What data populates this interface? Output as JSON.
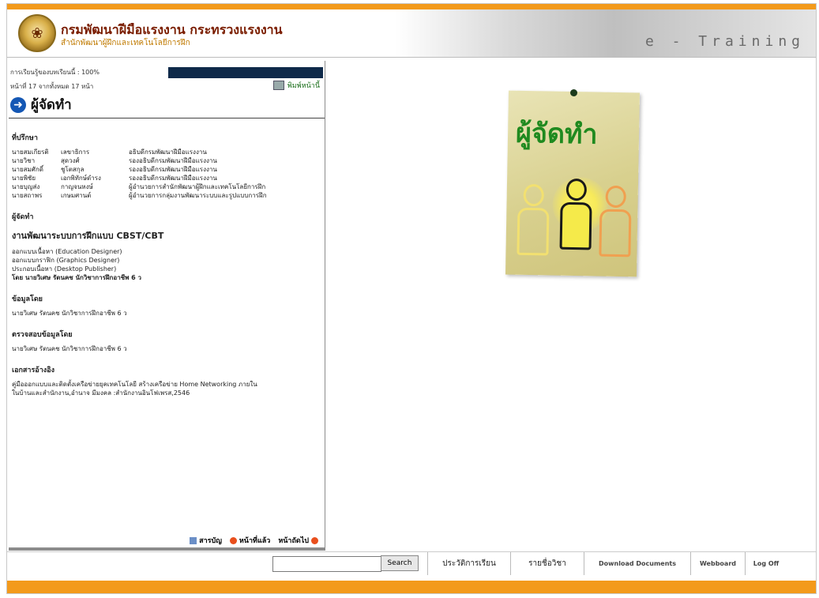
{
  "header": {
    "org_name": "กรมพัฒนาฝีมือแรงงาน กระทรวงแรงงาน",
    "org_sub": "สำนักพัฒนาผู้ฝึกและเทคโนโลยีการฝึก",
    "brand": "e - Training"
  },
  "progress": {
    "label": "การเรียนรู้ของบทเรียนนี้ : 100%",
    "value": 1.0
  },
  "page_info": "หน้าที่ 17 จากทั้งหมด 17 หน้า",
  "print_label": "พิมพ์หน้านี้",
  "page_title": "ผู้จัดทำ",
  "advisors": {
    "heading": "ที่ปรึกษา",
    "rows": [
      {
        "first": "นายสมเกียรติ",
        "last": "เลขาธิการ",
        "pos": "อธิบดีกรมพัฒนาฝีมือแรงงาน"
      },
      {
        "first": "นายวิชา",
        "last": "สุดวงศ์",
        "pos": "รองอธิบดีกรมพัฒนาฝีมือแรงงาน"
      },
      {
        "first": "นายสมศักดิ์",
        "last": "ชูโตสกุล",
        "pos": "รองอธิบดีกรมพัฒนาฝีมือแรงงาน"
      },
      {
        "first": "นายพิชัย",
        "last": "เอกพิทักษ์ดำรง",
        "pos": "รองอธิบดีกรมพัฒนาฝีมือแรงงาน"
      },
      {
        "first": "นายบุญส่ง",
        "last": "กาญจนหงษ์",
        "pos": "ผู้อำนวยการสำนักพัฒนาผู้ฝึกและเทคโนโลยีการฝึก"
      },
      {
        "first": "นายสถาพร",
        "last": "เกษมศานต์",
        "pos": "ผู้อำนวยการกลุ่มงานพัฒนาระบบและรูปแบบการฝึก"
      }
    ]
  },
  "authors": {
    "heading": "ผู้จัดทำ",
    "subheading": "งานพัฒนาระบบการฝึกแบบ CBST/CBT",
    "lines": [
      "ออกแบบเนื้อหา (Education Designer)",
      "ออกแบบกราฟิก (Graphics Designer)",
      "ประกอบเนื้อหา (Desktop Publisher)"
    ],
    "bold_line": "โดย นายวิเศษ รัตนคช นักวิชาการฝึกอาชีพ 6 ว"
  },
  "data_by": {
    "heading": "ข้อมูลโดย",
    "text": "นายวิเศษ รัตนคช นักวิชาการฝึกอาชีพ 6 ว"
  },
  "checked_by": {
    "heading": "ตรวจสอบข้อมูลโดย",
    "text": "นายวิเศษ รัตนคช นักวิชาการฝึกอาชีพ 6 ว"
  },
  "references": {
    "heading": "เอกสารอ้างอิง",
    "lines": [
      "คู่มือออกแบบและติดตั้งเครือข่ายยุคเทคโนโลยี สร้างเครือข่าย Home Networking ภายใน",
      "ในบ้านและสำนักงาน,อำนาจ มีมงคล :สำนักงานอินโฟเพรส,2546"
    ]
  },
  "nav": {
    "toc": "สารบัญ",
    "prev": "หน้าที่แล้ว",
    "next": "หน้าถัดไป"
  },
  "poster": {
    "title": "ผู้จัดทำ"
  },
  "bottom": {
    "search_placeholder": "",
    "search_button": "Search",
    "menu": [
      "ประวัติการเรียน",
      "รายชื่อวิชา",
      "Download Documents",
      "Webboard",
      "Log Off"
    ]
  },
  "colors": {
    "orange_bar": "#f39a1b",
    "progress_fill": "#0f2a4a",
    "title_arrow": "#1457b4",
    "poster_green": "#1f8a1f"
  }
}
